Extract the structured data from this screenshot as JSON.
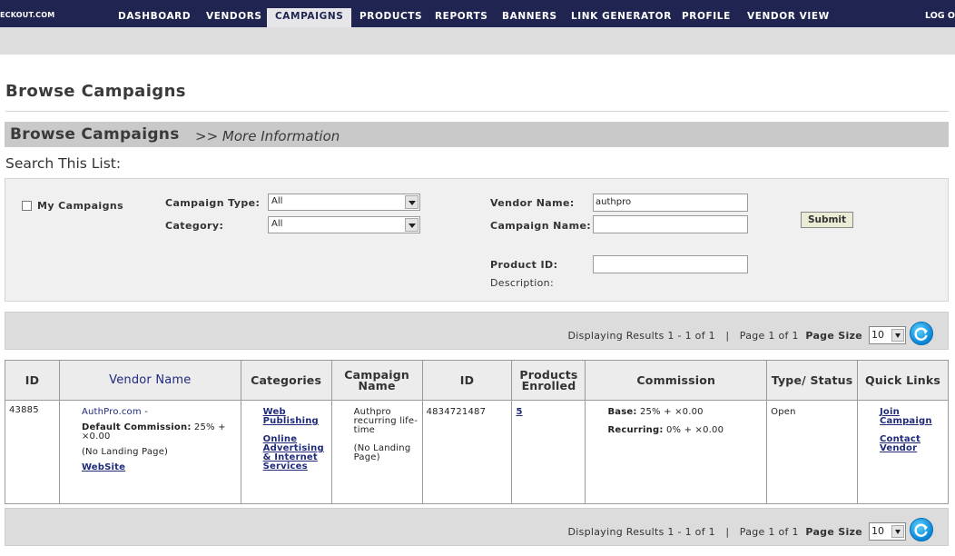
{
  "nav": {
    "logo": "ECKOUT.COM",
    "items": [
      "DASHBOARD",
      "VENDORS",
      "CAMPAIGNS",
      "PRODUCTS",
      "REPORTS",
      "BANNERS",
      "LINK GENERATOR",
      "PROFILE",
      "VENDOR VIEW"
    ],
    "active": "CAMPAIGNS",
    "logout": "LOG O"
  },
  "page": {
    "title": "Browse Campaigns",
    "section_title": "Browse Campaigns",
    "section_more": ">> More Information",
    "search_label": "Search This List:"
  },
  "search": {
    "my_campaigns_label": "My Campaigns",
    "campaign_type_label": "Campaign Type:",
    "campaign_type_value": "All",
    "category_label": "Category:",
    "category_value": "All",
    "vendor_name_label": "Vendor Name:",
    "vendor_name_value": "authpro",
    "campaign_name_label": "Campaign Name:",
    "campaign_name_value": "",
    "product_id_label": "Product ID:",
    "product_id_value": "",
    "description_label": "Description:",
    "submit_label": "Submit"
  },
  "results": {
    "displaying": "Displaying Results 1 - 1 of 1",
    "separator": "|",
    "page_text": "Page 1 of 1",
    "page_size_label": "Page Size",
    "page_size_value": "10"
  },
  "table": {
    "headers": [
      "ID",
      "Vendor Name",
      "Categories",
      "Campaign Name",
      "ID",
      "Products Enrolled",
      "Commission",
      "Type/ Status",
      "Quick Links"
    ],
    "row": {
      "id": "43885",
      "vendor_name": "AuthPro.com",
      "vendor_dash": "-",
      "default_commission_label": "Default Commission:",
      "default_commission_value": "25% + ×0.00",
      "landing": "(No Landing Page)",
      "website": "WebSite",
      "category_1": "Web Publishing",
      "category_2": "Online Advertising & Internet Services",
      "campaign_name": "Authpro recurring life-time",
      "campaign_landing": "(No Landing Page)",
      "campaign_id": "4834721487",
      "products_enrolled": "5",
      "base_label": "Base:",
      "base_value": "25% + ×0.00",
      "recurring_label": "Recurring:",
      "recurring_value": "0% + ×0.00",
      "status": "Open",
      "join_campaign": "Join Campaign",
      "contact_vendor": "Contact Vendor"
    }
  }
}
